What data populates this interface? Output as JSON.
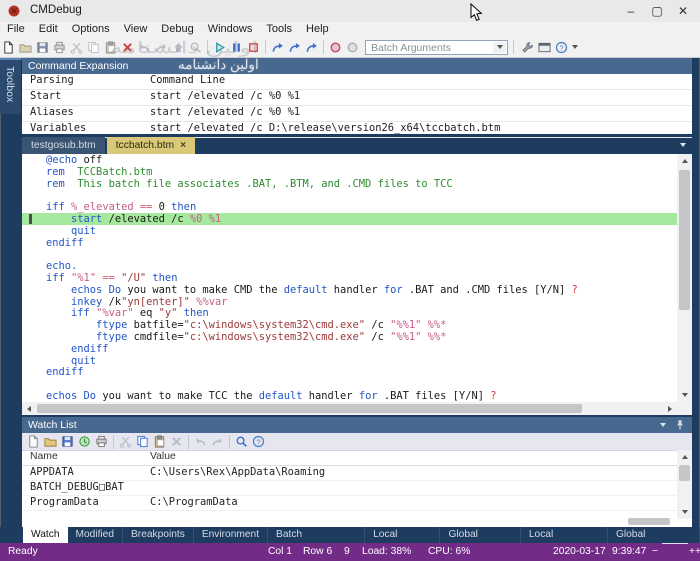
{
  "window": {
    "title": "CMDebug"
  },
  "titlebar_buttons": {
    "minimize": "–",
    "maximize": "▢",
    "close": "✕"
  },
  "menu": {
    "items": [
      "File",
      "Edit",
      "Options",
      "View",
      "Debug",
      "Windows",
      "Tools",
      "Help"
    ]
  },
  "toolbar": {
    "batch_arguments_placeholder": "Batch Arguments",
    "icons": [
      {
        "name": "new-file",
        "icon": "doc",
        "tone": "wash"
      },
      {
        "name": "open-file",
        "icon": "folder",
        "tone": "wash"
      },
      {
        "name": "save-file",
        "icon": "floppy",
        "tone": "wash"
      },
      {
        "name": "print",
        "icon": "printer",
        "tone": "wash"
      },
      {
        "name": "cut",
        "icon": "scissors",
        "tone": "dis"
      },
      {
        "name": "copy",
        "icon": "copy",
        "tone": "dis"
      },
      {
        "name": "paste",
        "icon": "paste",
        "tone": "wash"
      },
      {
        "name": "delete",
        "icon": "cross",
        "tone": "red"
      },
      {
        "name": "undo",
        "icon": "undo",
        "tone": "dis"
      },
      {
        "name": "redo",
        "icon": "redo",
        "tone": "dis"
      },
      {
        "name": "goto-line",
        "icon": "uparrow",
        "tone": "dis"
      },
      {
        "name": "find",
        "icon": "magnifier",
        "tone": "dis"
      },
      {
        "sep": true
      },
      {
        "name": "run",
        "icon": "play",
        "tone": "teal"
      },
      {
        "name": "pause",
        "icon": "pause",
        "tone": "blue"
      },
      {
        "name": "stop",
        "icon": "stop",
        "tone": "redout"
      },
      {
        "sep": true
      },
      {
        "name": "step-into",
        "icon": "step",
        "tone": "blue"
      },
      {
        "name": "step-over",
        "icon": "step",
        "tone": "blue"
      },
      {
        "name": "step-out",
        "icon": "step",
        "tone": "blue"
      },
      {
        "sep": true
      },
      {
        "name": "toggle-breakpoint",
        "icon": "circle",
        "tone": "pink"
      },
      {
        "name": "clear-breakpoints",
        "icon": "circle",
        "tone": "lite"
      }
    ]
  },
  "toolbox_tab": "Toolbox",
  "command_expansion": {
    "title": "Command Expansion",
    "columns": [
      "Parsing",
      "Command Line"
    ],
    "rows": [
      [
        "Start",
        "start /elevated /c %0 %1"
      ],
      [
        "Aliases",
        "start /elevated /c %0 %1"
      ],
      [
        "Variables",
        "start /elevated /c D:\\release\\version26_x64\\tccbatch.btm"
      ]
    ]
  },
  "editor": {
    "tabs": [
      {
        "label": "testgosub.btm",
        "active": false
      },
      {
        "label": "tccbatch.btm",
        "active": true,
        "close": "×"
      }
    ],
    "lines": [
      {
        "segs": [
          [
            "k",
            "@echo"
          ],
          [
            "t",
            " off"
          ]
        ]
      },
      {
        "segs": [
          [
            "k",
            "rem"
          ],
          [
            "c",
            "  TCCBatch.btm"
          ]
        ]
      },
      {
        "segs": [
          [
            "k",
            "rem"
          ],
          [
            "c",
            "  This batch file associates .BAT, .BTM, and .CMD files to TCC"
          ]
        ]
      },
      {
        "segs": []
      },
      {
        "segs": [
          [
            "k",
            "iff"
          ],
          [
            "t",
            " "
          ],
          [
            "v",
            "%_elevated"
          ],
          [
            "t",
            " "
          ],
          [
            "o",
            "=="
          ],
          [
            "t",
            " 0 "
          ],
          [
            "k",
            "then"
          ]
        ]
      },
      {
        "hl": true,
        "segs": [
          [
            "t",
            "    "
          ],
          [
            "k",
            "start"
          ],
          [
            "t",
            " /elevated /c "
          ],
          [
            "v",
            "%0 %1"
          ]
        ]
      },
      {
        "segs": [
          [
            "t",
            "    "
          ],
          [
            "k",
            "quit"
          ]
        ]
      },
      {
        "segs": [
          [
            "k",
            "endiff"
          ]
        ]
      },
      {
        "segs": []
      },
      {
        "segs": [
          [
            "k",
            "echo."
          ]
        ]
      },
      {
        "segs": [
          [
            "k",
            "iff"
          ],
          [
            "t",
            " "
          ],
          [
            "v",
            "\"%1\""
          ],
          [
            "t",
            " "
          ],
          [
            "o",
            "=="
          ],
          [
            "t",
            " "
          ],
          [
            "s",
            "\"/U\""
          ],
          [
            "t",
            " "
          ],
          [
            "k",
            "then"
          ]
        ]
      },
      {
        "segs": [
          [
            "t",
            "    "
          ],
          [
            "k",
            "echos"
          ],
          [
            "t",
            " "
          ],
          [
            "k",
            "Do"
          ],
          [
            "t",
            " you want to make CMD the "
          ],
          [
            "k",
            "default"
          ],
          [
            "t",
            " handler "
          ],
          [
            "k",
            "for"
          ],
          [
            "t",
            " .BAT and .CMD files [Y/N] "
          ],
          [
            "q",
            "?"
          ]
        ]
      },
      {
        "segs": [
          [
            "t",
            "    "
          ],
          [
            "k",
            "inkey"
          ],
          [
            "t",
            " /k"
          ],
          [
            "s",
            "\"yn[enter]\""
          ],
          [
            "t",
            " "
          ],
          [
            "v",
            "%%var"
          ]
        ]
      },
      {
        "segs": [
          [
            "t",
            "    "
          ],
          [
            "k",
            "iff"
          ],
          [
            "t",
            " "
          ],
          [
            "v",
            "\"%var\""
          ],
          [
            "t",
            " eq "
          ],
          [
            "s",
            "\"y\""
          ],
          [
            "t",
            " "
          ],
          [
            "k",
            "then"
          ]
        ]
      },
      {
        "segs": [
          [
            "t",
            "        "
          ],
          [
            "k",
            "ftype"
          ],
          [
            "t",
            " batfile="
          ],
          [
            "s",
            "\"c:\\windows\\system32\\cmd.exe\""
          ],
          [
            "t",
            " /c "
          ],
          [
            "v",
            "\"%%1\""
          ],
          [
            "t",
            " "
          ],
          [
            "v",
            "%%*"
          ]
        ]
      },
      {
        "segs": [
          [
            "t",
            "        "
          ],
          [
            "k",
            "ftype"
          ],
          [
            "t",
            " cmdfile="
          ],
          [
            "s",
            "\"c:\\windows\\system32\\cmd.exe\""
          ],
          [
            "t",
            " /c "
          ],
          [
            "v",
            "\"%%1\""
          ],
          [
            "t",
            " "
          ],
          [
            "v",
            "%%*"
          ]
        ]
      },
      {
        "segs": [
          [
            "t",
            "    "
          ],
          [
            "k",
            "endiff"
          ]
        ]
      },
      {
        "segs": [
          [
            "t",
            "    "
          ],
          [
            "k",
            "quit"
          ]
        ]
      },
      {
        "segs": [
          [
            "k",
            "endiff"
          ]
        ]
      },
      {
        "segs": []
      },
      {
        "segs": [
          [
            "k",
            "echos"
          ],
          [
            "t",
            " "
          ],
          [
            "k",
            "Do"
          ],
          [
            "t",
            " you want to make TCC the "
          ],
          [
            "k",
            "default"
          ],
          [
            "t",
            " handler "
          ],
          [
            "k",
            "for"
          ],
          [
            "t",
            " .BAT files [Y/N] "
          ],
          [
            "q",
            "?"
          ]
        ]
      }
    ]
  },
  "watch": {
    "title": "Watch List",
    "columns": [
      "Name",
      "Value"
    ],
    "rows": [
      [
        "APPDATA",
        "C:\\Users\\Rex\\AppData\\Roaming"
      ],
      [
        "BATCH_DEBUG□BAT",
        ""
      ],
      [
        "ProgramData",
        "C:\\ProgramData"
      ]
    ],
    "icons": [
      {
        "name": "new-watch",
        "icon": "doc",
        "tone": "gray"
      },
      {
        "name": "open-watch",
        "icon": "folder",
        "tone": ""
      },
      {
        "name": "save-watch",
        "icon": "floppy",
        "tone": ""
      },
      {
        "name": "auto-refresh",
        "icon": "clock",
        "tone": ""
      },
      {
        "name": "print-watch",
        "icon": "printer",
        "tone": ""
      },
      {
        "sep": true
      },
      {
        "name": "cut-watch",
        "icon": "scissors",
        "tone": "dis"
      },
      {
        "name": "copy-watch",
        "icon": "copy",
        "tone": "blue"
      },
      {
        "name": "paste-watch",
        "icon": "paste",
        "tone": ""
      },
      {
        "name": "delete-watch",
        "icon": "cross",
        "tone": "dis"
      },
      {
        "sep": true
      },
      {
        "name": "undo-watch",
        "icon": "undo",
        "tone": "dis"
      },
      {
        "name": "redo-watch",
        "icon": "redo",
        "tone": "dis"
      },
      {
        "sep": true
      },
      {
        "name": "find-watch",
        "icon": "magnifier",
        "tone": "blue"
      },
      {
        "name": "help-watch",
        "icon": "helpc",
        "tone": "blue"
      }
    ]
  },
  "bottom_tabs": [
    {
      "label": "Watch",
      "active": true
    },
    {
      "label": "Modified",
      "active": false
    },
    {
      "label": "Breakpoints",
      "active": false
    },
    {
      "label": "Environment",
      "active": false
    },
    {
      "label": "Batch Parameters",
      "active": false
    },
    {
      "label": "Local Aliases",
      "active": false
    },
    {
      "label": "Global Aliases",
      "active": false
    },
    {
      "label": "Local Functions",
      "active": false
    },
    {
      "label": "Global Functions",
      "active": false
    }
  ],
  "status": {
    "ready": "Ready",
    "col": "Col 1",
    "row": "Row 6",
    "count": "9",
    "load": "Load: 38%",
    "cpu": "CPU: 6%",
    "date": "2020-03-17",
    "time": "9:39:47"
  },
  "watermark": "اولین دانشنامه",
  "colors": {
    "frame_navy": "#1e3c60",
    "panel_header_blue": "#47688f",
    "active_tab_khaki": "#d9c878",
    "current_line_green": "#a6e99e",
    "status_bar_purple": "#722c87",
    "keyword_blue": "#2356c8",
    "comment_green": "#2e8b2e",
    "string_maroon": "#9c3838",
    "variable_pink": "#c75b88"
  }
}
